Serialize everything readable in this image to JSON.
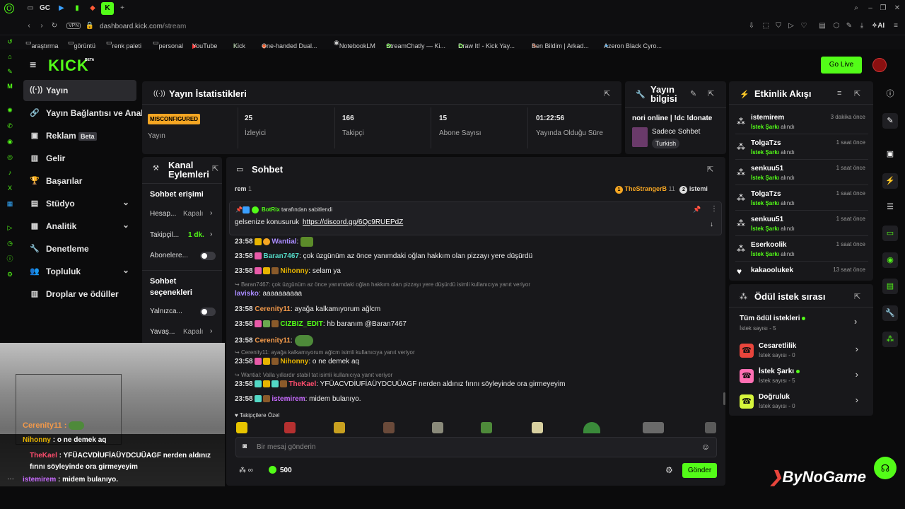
{
  "browser": {
    "tabs": [
      "GC"
    ],
    "url_host": "dashboard.kick.com",
    "url_path": "/stream",
    "vpn": "VPN",
    "ai": "AI",
    "bookmarks": [
      "araştırma",
      "görüntü",
      "renk paleti",
      "personal",
      "YouTube",
      "Kick",
      "One-handed Dual...",
      "NotebookLM",
      "StreamChatly — Ki...",
      "Draw It! - Kick Yay...",
      "Ben Bildim | Arkad...",
      "Azeron Black Cyro..."
    ]
  },
  "header": {
    "logo": "KICK",
    "beta": "BETA",
    "go_live": "Go Live"
  },
  "nav": {
    "items": [
      {
        "label": "Yayın",
        "icon": "broadcast-icon"
      },
      {
        "label": "Yayın Bağlantısı ve Anahtar",
        "icon": "link-icon"
      },
      {
        "label": "Reklam",
        "badge": "Beta",
        "icon": "ad-icon"
      },
      {
        "label": "Gelir",
        "icon": "chart-icon"
      },
      {
        "label": "Başarılar",
        "icon": "trophy-icon"
      },
      {
        "label": "Stüdyo",
        "icon": "studio-icon"
      },
      {
        "label": "Analitik",
        "icon": "analytics-icon"
      },
      {
        "label": "Denetleme",
        "icon": "wrench-icon"
      },
      {
        "label": "Topluluk",
        "icon": "community-icon"
      },
      {
        "label": "Droplar ve ödüller",
        "icon": "gift-icon"
      }
    ]
  },
  "stats": {
    "title": "Yayın İstatistikleri",
    "status_badge": "MISCONFIGURED",
    "status_label": "Yayın",
    "cards": [
      {
        "value": "25",
        "label": "İzleyici"
      },
      {
        "value": "166",
        "label": "Takipçi"
      },
      {
        "value": "15",
        "label": "Abone Sayısı"
      },
      {
        "value": "01:22:56",
        "label": "Yayında Olduğu Süre"
      }
    ]
  },
  "info": {
    "title": "Yayın bilgisi",
    "stream_title": "nori online | !dc !donate",
    "category": "Sadece Sohbet",
    "tag": "Turkish"
  },
  "channel_actions": {
    "title": "Kanal Eylemleri",
    "chat_access_title": "Sohbet erişimi",
    "rows": [
      {
        "label": "Hesap...",
        "value": "Kapalı"
      },
      {
        "label": "Takipçil...",
        "value": "1 dk."
      },
      {
        "label": "Abonelere..."
      }
    ],
    "chat_options_title": "Sohbet seçenekleri",
    "options": [
      {
        "label": "Yalnızca..."
      },
      {
        "label": "Yavaş...",
        "value": "Kapalı"
      }
    ]
  },
  "chat": {
    "title": "Sohbet",
    "top_left": "rem",
    "top_left_count": "1",
    "top_user": "TheStrangerB",
    "top_user_count": "11",
    "top_user2": "istemi",
    "pinned_by": "BotRix",
    "pinned_suffix": "tarafından sabitlendi",
    "pinned_text": "gelsenize konusuruk",
    "pinned_link": "https://discord.gg/6Qc9RUEPdZ",
    "messages": [
      {
        "time": "23:58",
        "user": "Wantial",
        "text": "",
        "color": "#a98bff",
        "reply": ""
      },
      {
        "time": "23:58",
        "user": "Baran7467",
        "text": "çok üzgünüm az önce yanımdaki oğlan hakkım olan pizzayı yere düşürdü",
        "color": "#53d8c6",
        "reply": ""
      },
      {
        "time": "23:58",
        "user": "Nihonny",
        "text": "selam ya",
        "color": "#e7b400",
        "reply": ""
      },
      {
        "time": "",
        "user": "lavisko",
        "text": "aaaaaaaaaa",
        "color": "#a98bff",
        "reply": "Baran7467: çok üzgünüm az önce yanımdaki oğlan hakkım olan pizzayı yere düşürdü isimli kullanıcıya yanıt veriyor"
      },
      {
        "time": "23:58",
        "user": "Cerenity11",
        "text": "ayağa kalkamıyorum ağlcm",
        "color": "#f2994a",
        "reply": ""
      },
      {
        "time": "23:58",
        "user": "CIZBIZ_EDIT",
        "text": "hb baranım @Baran7467",
        "color": "#53fc18",
        "reply": ""
      },
      {
        "time": "23:58",
        "user": "Cerenity11",
        "text": "",
        "color": "#f2994a",
        "reply": ""
      },
      {
        "time": "23:58",
        "user": "Nihonny",
        "text": "o ne demek aq",
        "color": "#e7b400",
        "reply": "Cerenity11: ayağa kalkamıyorum ağlcm isimli kullanıcıya yanıt veriyor"
      },
      {
        "time": "23:58",
        "user": "TheKael",
        "text": "YFÜACVDİUFİAÜYDCUÜAGF nerden aldınız fırını söyleyinde ora girmeyeyim",
        "color": "#ff4d6d",
        "reply": "Wantial: Valla yıllardır stabil tat isimli kullanıcıya yanıt veriyor"
      },
      {
        "time": "23:58",
        "user": "istemirem",
        "text": "midem bulanıyo.",
        "color": "#c86bff",
        "reply": ""
      }
    ],
    "followers_only": "Takipçilere Özel",
    "placeholder": "Bir mesaj gönderin",
    "points": "500",
    "send": "Gönder"
  },
  "events": {
    "title": "Etkinlik Akışı",
    "items": [
      {
        "name": "istemirem",
        "action": "İstek Şarkı",
        "suffix": "alındı",
        "time": "3 dakika önce"
      },
      {
        "name": "TolgaTzs",
        "action": "İstek Şarkı",
        "suffix": "alındı",
        "time": "1 saat önce"
      },
      {
        "name": "senkuu51",
        "action": "İstek Şarkı",
        "suffix": "alındı",
        "time": "1 saat önce"
      },
      {
        "name": "TolgaTzs",
        "action": "İstek Şarkı",
        "suffix": "alındı",
        "time": "1 saat önce"
      },
      {
        "name": "senkuu51",
        "action": "İstek Şarkı",
        "suffix": "alındı",
        "time": "1 saat önce"
      },
      {
        "name": "Eserkoolik",
        "action": "İstek Şarkı",
        "suffix": "alındı",
        "time": "1 saat önce"
      },
      {
        "name": "kakaoolukek",
        "action": "",
        "suffix": "",
        "time": "13 saat önce"
      }
    ]
  },
  "rewards": {
    "title": "Ödül istek sırası",
    "all_label": "Tüm ödül istekleri",
    "all_count": "İstek sayısı - 5",
    "items": [
      {
        "name": "Cesaretlilik",
        "count": "İstek sayısı - 0",
        "color": "#e8453c"
      },
      {
        "name": "İstek Şarkı",
        "count": "İstek sayısı - 5",
        "color": "#ff6fb3"
      },
      {
        "name": "Doğruluk",
        "count": "İstek sayısı - 0",
        "color": "#d6f53c"
      }
    ]
  },
  "overlay": {
    "lines": [
      {
        "user": "Cerenity11",
        "text": "",
        "color": "#f2994a"
      },
      {
        "user": "Nihonny",
        "text": "o ne demek aq",
        "color": "#e7b400"
      },
      {
        "user": "TheKael",
        "text": "YFÜACVDİUFİAÜYDCUÜAGF nerden aldınız fırını söyleyinde ora girmeyeyim",
        "color": "#ff4d6d"
      },
      {
        "user": "istemirem",
        "text": "midem bulanıyo.",
        "color": "#c86bff"
      }
    ]
  },
  "watermark": "ByNoGame",
  "colors": {
    "accent": "#53fc18",
    "panel": "#18181b",
    "bg": "#0b0b0c"
  }
}
